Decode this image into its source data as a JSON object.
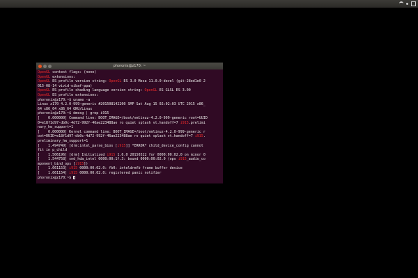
{
  "terminal": {
    "title": "phoronix@z170: ~",
    "lines": [
      [
        {
          "t": "OpenGL",
          "r": true
        },
        {
          "t": " context flags: (none)"
        }
      ],
      [
        {
          "t": "OpenGL",
          "r": true
        },
        {
          "t": " extensions:"
        }
      ],
      [
        {
          "t": "OpenGL",
          "r": true
        },
        {
          "t": " ES profile version string: "
        },
        {
          "t": "OpenGL",
          "r": true
        },
        {
          "t": " ES 3.0 Mesa 11.0.0-devel (git-28ed1e0 2"
        }
      ],
      [
        {
          "t": "015-08-14 vivid-oibaf-ppa)"
        }
      ],
      [
        {
          "t": "OpenGL",
          "r": true
        },
        {
          "t": " ES profile shading language version string: "
        },
        {
          "t": "OpenGL",
          "r": true
        },
        {
          "t": " ES GLSL ES 3.00"
        }
      ],
      [
        {
          "t": "OpenGL",
          "r": true
        },
        {
          "t": " ES profile extensions:"
        }
      ],
      [
        {
          "t": "phoronix@z170:~$ uname -a"
        }
      ],
      [
        {
          "t": "Linux z170 4.2.0-999-generic #201508142200 SMP Sat Aug 15 02:02:03 UTC 2015 x86_"
        }
      ],
      [
        {
          "t": "64 x86_64 x86_64 GNU/Linux"
        }
      ],
      [
        {
          "t": "phoronix@z170:~$ dmesg | grep i915"
        }
      ],
      [
        {
          "t": "[    0.000000] Command line: BOOT_IMAGE=/boot/vmlinuz-4.2.0-999-generic root=UUID"
        }
      ],
      [
        {
          "t": "0=e18f1d97-db0c-4d72-992f-46ae223488ae ro quiet splash vt.handoff=7 "
        },
        {
          "t": "i915",
          "r": true
        },
        {
          "t": ".prelimi"
        }
      ],
      [
        {
          "t": "nary_hw_support=1"
        }
      ],
      [
        {
          "t": "[    0.000000] Kernel command line: BOOT_IMAGE=/boot/vmlinuz-4.2.0-999-generic r"
        }
      ],
      [
        {
          "t": "oot=UUID=e18f1d97-db0c-4d72-992f-46ae223488ae ro quiet splash vt.handoff=7 "
        },
        {
          "t": "i915",
          "r": true
        },
        {
          "t": "."
        }
      ],
      [
        {
          "t": "preliminary_hw_support=1"
        }
      ],
      [
        {
          "t": "[    1.494749] [drm:intel_parse_bios ["
        },
        {
          "t": "i915",
          "r": true
        },
        {
          "t": "]] *ERROR* child_device_config cannot"
        }
      ],
      [
        {
          "t": "fit in p_child"
        }
      ],
      [
        {
          "t": "[    1.506196] [drm] Initialized "
        },
        {
          "t": "i915",
          "r": true
        },
        {
          "t": " 1.6.0 20150522 for 0000:00:02.0 on minor 0"
        }
      ],
      [
        {
          "t": "[    1.544758] snd_hda_intel 0000:00:1f.3: bound 0000:00:02.0 (ops "
        },
        {
          "t": "i915",
          "r": true
        },
        {
          "t": "_audio_co"
        }
      ],
      [
        {
          "t": "mponent_bind_ops ["
        },
        {
          "t": "i915",
          "r": true
        },
        {
          "t": "])"
        }
      ],
      [
        {
          "t": "[    1.661153] "
        },
        {
          "t": "i915",
          "r": true
        },
        {
          "t": " 0000:00:02.0: fb0: inteldrmfb frame buffer device"
        }
      ],
      [
        {
          "t": "[    1.661154] "
        },
        {
          "t": "i915",
          "r": true
        },
        {
          "t": " 0000:00:02.0: registered panic notifier"
        }
      ],
      [
        {
          "t": "phoronix@z170:~$ "
        }
      ]
    ]
  },
  "colors": {
    "terminal_bg": "#300a24",
    "highlight": "#ef2929",
    "text": "#eeeeec"
  }
}
